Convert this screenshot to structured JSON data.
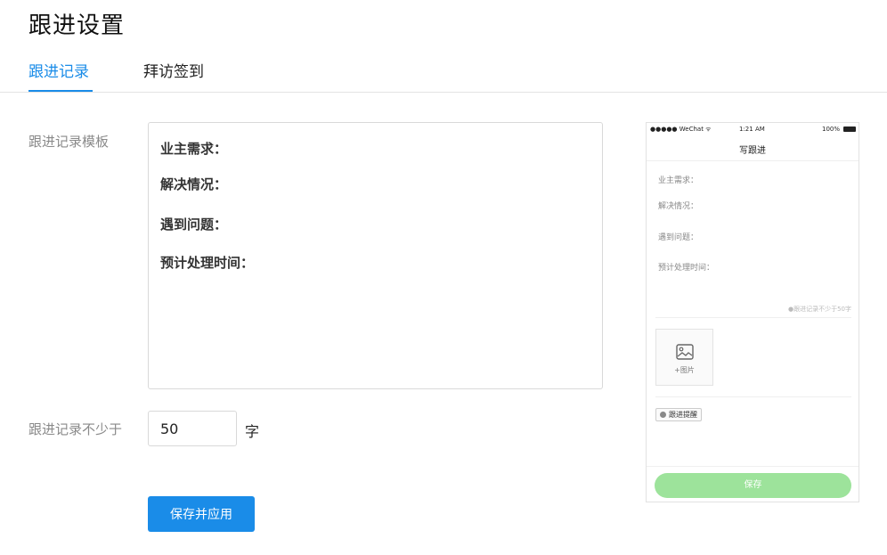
{
  "page": {
    "title": "跟进设置"
  },
  "tabs": [
    {
      "label": "跟进记录",
      "active": true
    },
    {
      "label": "拜访签到",
      "active": false
    }
  ],
  "form": {
    "template_label": "跟进记录模板",
    "template_lines": [
      "业主需求：",
      "解决情况：",
      "遇到问题：",
      "预计处理时间："
    ],
    "min_label": "跟进记录不少于",
    "min_value": "50",
    "min_unit": "字",
    "apply_button": "保存并应用"
  },
  "preview": {
    "status_left": "●●●●● WeChat ᯤ",
    "status_time": "1:21 AM",
    "status_battery": "100%",
    "nav_title": "写跟进",
    "lines": [
      "业主需求：",
      "解决情况：",
      "遇到问题：",
      "预计处理时间："
    ],
    "hint": "●跟进记录不少于50字",
    "add_image_label": "+图片",
    "remind_label": "跟进提醒",
    "save_label": "保存"
  },
  "colors": {
    "accent": "#1a8ce8",
    "save_green": "#9de39b"
  }
}
